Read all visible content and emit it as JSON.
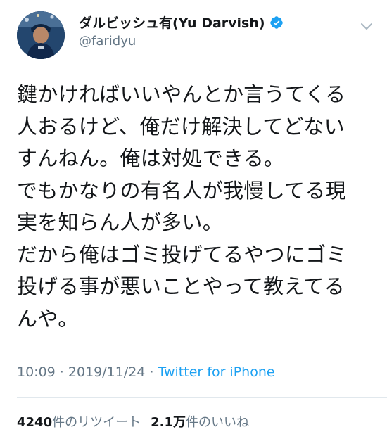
{
  "user": {
    "display_name": "ダルビッシュ有(Yu Darvish)",
    "handle": "@faridyu",
    "verified": true
  },
  "tweet": {
    "lines": [
      "鍵かければいいやんとか言うてくる",
      "人おるけど、俺だけ解決してどない",
      "すんねん。俺は対処できる。",
      "でもかなりの有名人が我慢してる現",
      "実を知らん人が多い。",
      "だから俺はゴミ投げてるやつにゴミ",
      "投げる事が悪いことやって教えてる",
      "んや。"
    ]
  },
  "meta": {
    "time": "10:09",
    "separator1": " · ",
    "date": "2019/11/24",
    "separator2": " · ",
    "source": "Twitter for iPhone"
  },
  "stats": {
    "retweets_count": "4240",
    "retweets_label": "件のリツイート",
    "likes_count": "2.1万",
    "likes_label": "件のいいね"
  },
  "icons": {
    "verified": "verified-badge-icon",
    "menu": "chevron-down-icon"
  },
  "colors": {
    "verified_blue": "#1da1f2",
    "secondary_text": "#657786",
    "link": "#1da1f2"
  }
}
